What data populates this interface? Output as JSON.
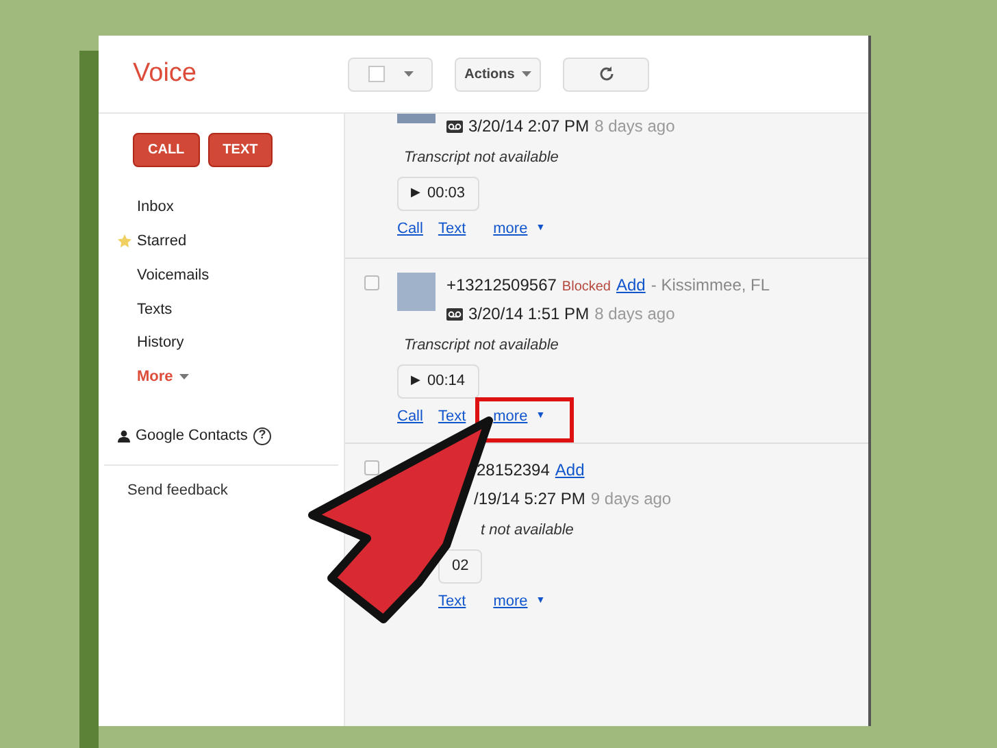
{
  "app": {
    "title": "Voice"
  },
  "toolbar": {
    "actions_label": "Actions"
  },
  "sidebar": {
    "buttons": [
      "CALL",
      "TEXT"
    ],
    "items": [
      {
        "label": "Inbox",
        "kind": "plain"
      },
      {
        "label": "Starred",
        "kind": "starred"
      },
      {
        "label": "Voicemails",
        "kind": "plain"
      },
      {
        "label": "Texts",
        "kind": "plain"
      },
      {
        "label": "History",
        "kind": "plain"
      },
      {
        "label": "More",
        "kind": "more"
      }
    ],
    "contacts": "Google Contacts",
    "help": "?",
    "feedback": "Send feedback"
  },
  "messages": [
    {
      "kind": "top_cut",
      "date": "3/20/14 2:07 PM",
      "ago": "8 days ago",
      "transcript": "Transcript not available",
      "play": "▶",
      "duration": "00:03",
      "links": [
        "Call",
        "Text",
        "more"
      ],
      "caret": "▼"
    },
    {
      "kind": "full",
      "checked": false,
      "number": "+13212509567",
      "blocked": "Blocked",
      "add": "Add",
      "location": "- Kissimmee, FL",
      "date": "3/20/14 1:51 PM",
      "ago": "8 days ago",
      "transcript": "Transcript not available",
      "play": "▶",
      "duration": "00:14",
      "links": [
        "Call",
        "Text",
        "more"
      ],
      "caret": "▼"
    },
    {
      "kind": "obscured",
      "checked": false,
      "number": "28152394",
      "add": "Add",
      "date": "/19/14 5:27 PM",
      "ago": "9 days ago",
      "transcript": "t not available",
      "duration": "02",
      "links": [
        "Text",
        "more"
      ],
      "caret": "▼"
    }
  ]
}
